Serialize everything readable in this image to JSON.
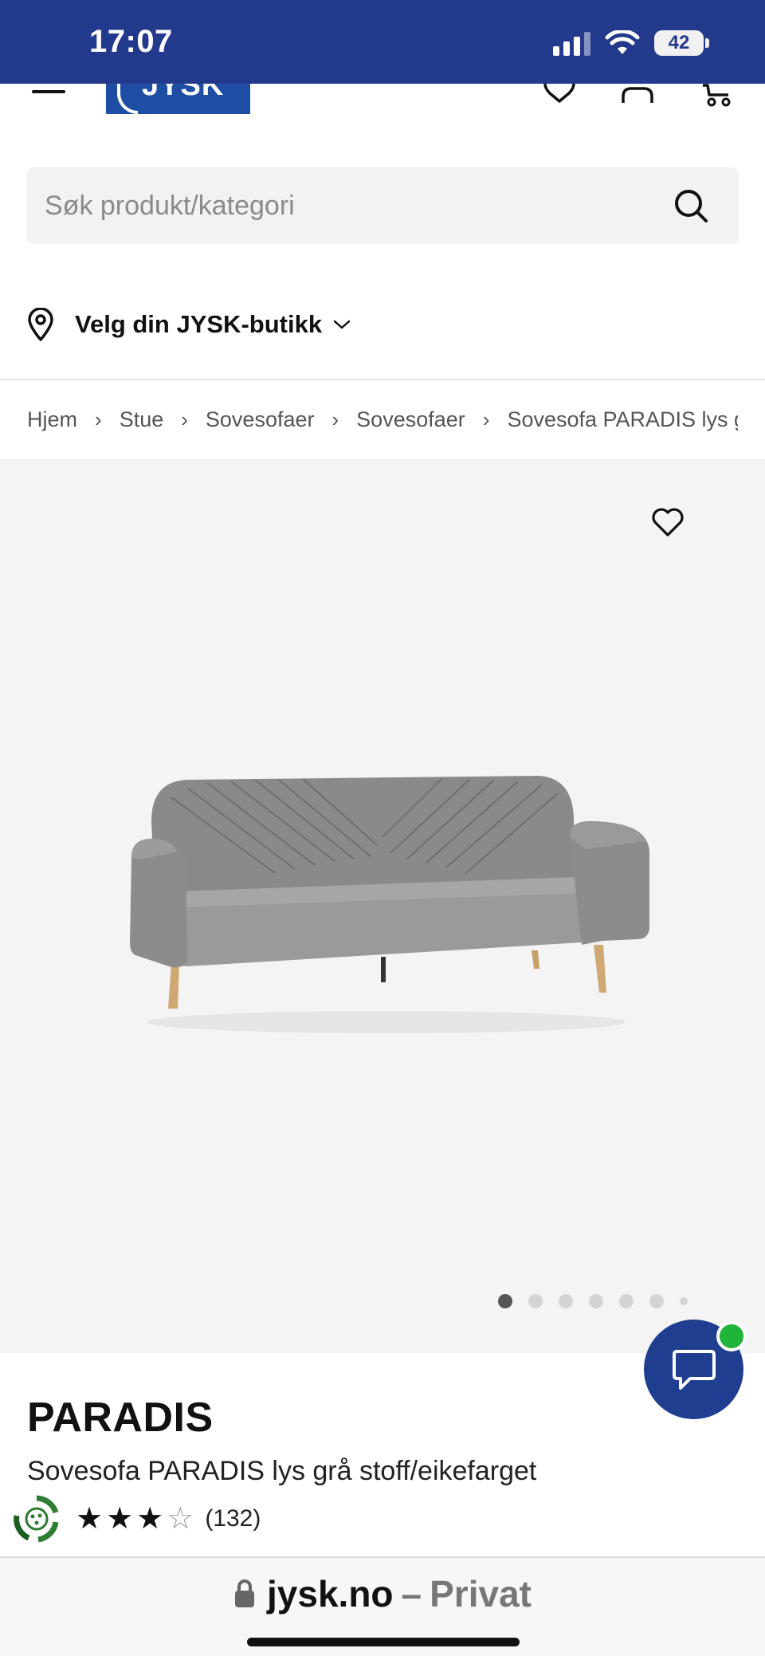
{
  "status_bar": {
    "time": "17:07",
    "battery": "42"
  },
  "header": {
    "logo_text": "JYSK"
  },
  "search": {
    "placeholder": "Søk produkt/kategori"
  },
  "store_selector": {
    "label": "Velg din JYSK-butikk"
  },
  "breadcrumb": [
    "Hjem",
    "Stue",
    "Sovesofaer",
    "Sovesofaer",
    "Sovesofa PARADIS lys grå stoff/eikefarget"
  ],
  "gallery": {
    "image_count": 7,
    "active_index": 0
  },
  "product": {
    "title": "PARADIS",
    "subtitle": "Sovesofa PARADIS lys grå stoff/eikefarget",
    "rating": 3,
    "rating_max": 5,
    "review_count": "(132)"
  },
  "browser": {
    "domain": "jysk.no",
    "separator": "–",
    "mode": "Privat"
  },
  "colors": {
    "brand_blue": "#233a8c",
    "logo_blue": "#1d4ea3",
    "chat_online": "#20b43a"
  },
  "icons": [
    "signal-icon",
    "wifi-icon",
    "battery-icon",
    "menu-icon",
    "heart-icon",
    "user-icon",
    "cart-icon",
    "search-icon",
    "location-pin-icon",
    "chevron-down-icon",
    "chevron-right-icon",
    "favorite-icon",
    "chat-icon",
    "recycle-icon",
    "lock-icon"
  ]
}
